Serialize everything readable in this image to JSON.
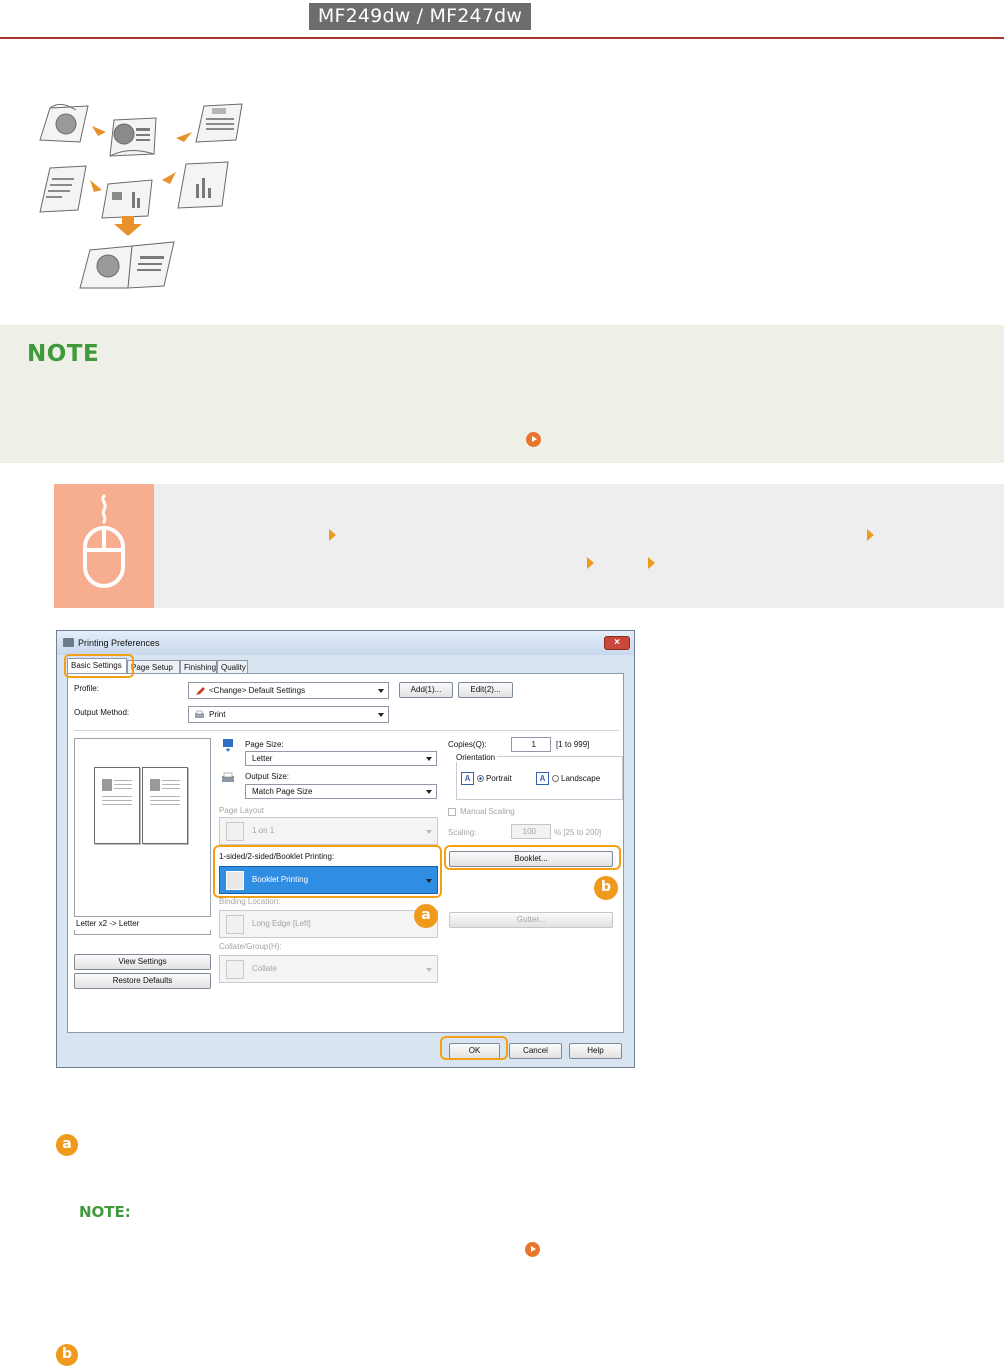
{
  "header": {
    "model_badge": "MF249dw / MF247dw"
  },
  "illustration": {
    "icon": "booklet-printing-illustration"
  },
  "note": {
    "title": "NOTE",
    "link_icon": "circle-arrow-icon"
  },
  "procedure": {
    "icon": "mouse-icon",
    "step_arrow_icon": "triangle-arrow-icon"
  },
  "dialog": {
    "title": "Printing Preferences",
    "close": "×",
    "tabs": [
      "Basic Settings",
      "Page Setup",
      "Finishing",
      "Quality"
    ],
    "profile_label": "Profile:",
    "profile_value": "<Change> Default Settings",
    "add_button": "Add(1)...",
    "edit_button": "Edit(2)...",
    "output_method_label": "Output Method:",
    "output_method_value": "Print",
    "preview_caption": "Letter x2 -> Letter",
    "view_settings_button": "View Settings",
    "restore_defaults_button": "Restore Defaults",
    "page_size_label": "Page Size:",
    "page_size_value": "Letter",
    "output_size_label": "Output Size:",
    "output_size_value": "Match Page Size",
    "page_layout_label": "Page Layout",
    "page_layout_value": "1 on 1",
    "duplex_label": "1-sided/2-sided/Booklet Printing:",
    "duplex_value": "Booklet Printing",
    "binding_label": "Binding Location:",
    "binding_value": "Long Edge [Left]",
    "collate_label": "Collate/Group(H):",
    "collate_value": "Collate",
    "copies_label": "Copies(Q):",
    "copies_value": "1",
    "copies_range": "[1 to 999]",
    "orientation_label": "Orientation",
    "portrait_label": "Portrait",
    "landscape_label": "Landscape",
    "manual_scaling_label": "Manual Scaling",
    "scaling_label": "Scaling:",
    "scaling_value": "100",
    "scaling_range": "% [25 to 200]",
    "booklet_button": "Booklet...",
    "gutter_button": "Gutter...",
    "ok_button": "OK",
    "cancel_button": "Cancel",
    "help_button": "Help",
    "orientation_glyph": "A"
  },
  "callouts": {
    "a": "a",
    "b": "b"
  },
  "annotations": {
    "a_badge": "a",
    "note_title": "NOTE:",
    "b_badge": "b"
  },
  "colors": {
    "accent_red": "#a8362c",
    "note_green": "#3e9a3a",
    "highlight_orange": "#f3a017",
    "selection_blue": "#2f8de4",
    "mouse_tile": "#f6ad90"
  }
}
